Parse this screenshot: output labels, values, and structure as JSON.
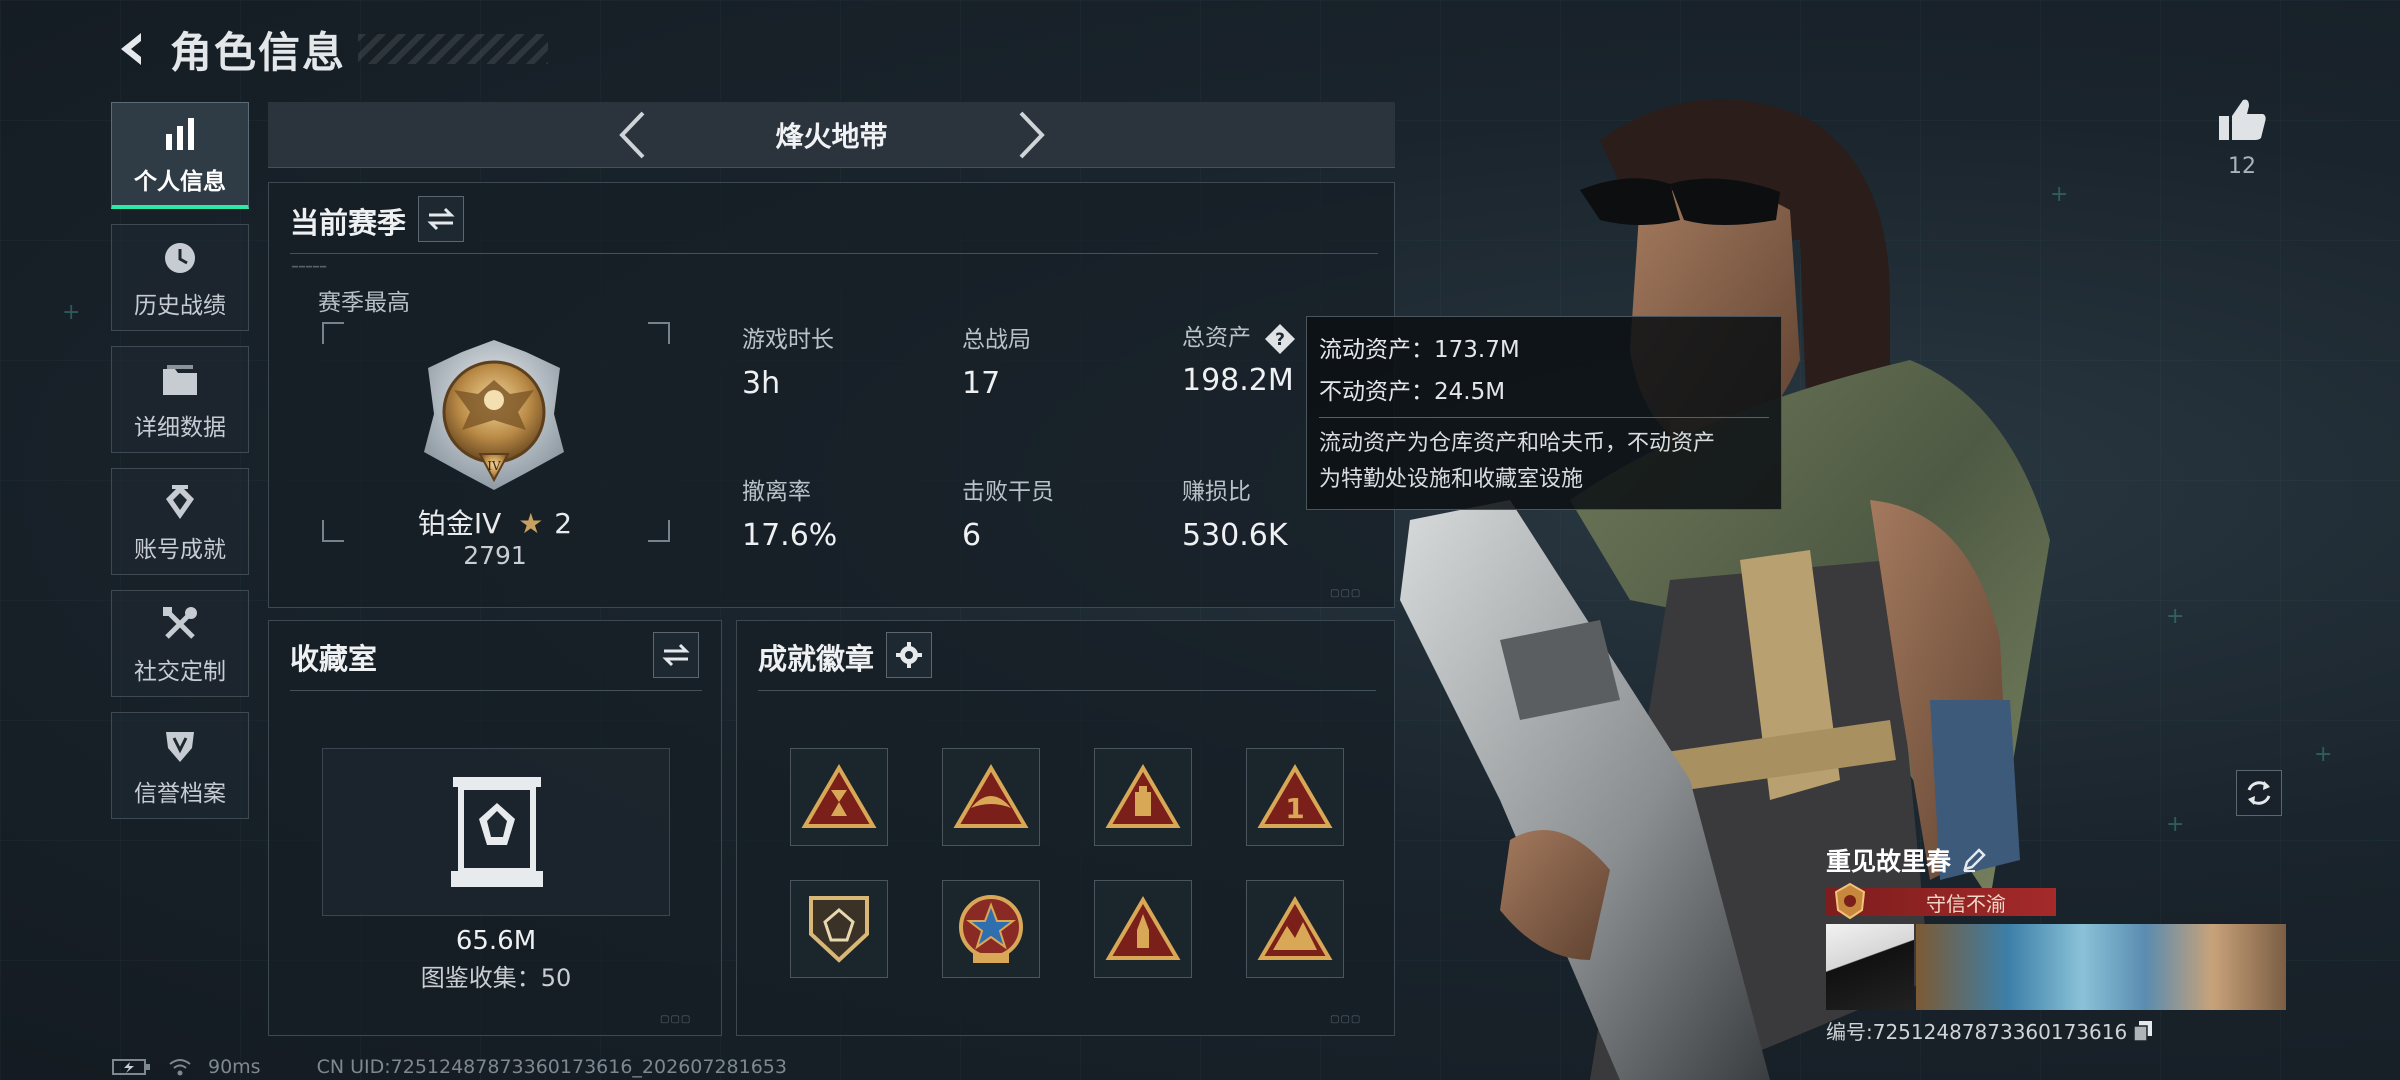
{
  "header": {
    "title": "角色信息"
  },
  "sidebar": {
    "items": [
      {
        "label": "个人信息",
        "icon": "bar-chart-icon",
        "active": true
      },
      {
        "label": "历史战绩",
        "icon": "history-icon",
        "active": false
      },
      {
        "label": "详细数据",
        "icon": "folder-icon",
        "active": false
      },
      {
        "label": "账号成就",
        "icon": "achievement-icon",
        "active": false
      },
      {
        "label": "社交定制",
        "icon": "tools-icon",
        "active": false
      },
      {
        "label": "信誉档案",
        "icon": "shield-icon",
        "active": false
      }
    ]
  },
  "mode": {
    "name": "烽火地带"
  },
  "season": {
    "title": "当前赛季",
    "best_label": "赛季最高",
    "rank_name": "铂金IV",
    "rank_stars": "2",
    "rank_score": "2791",
    "stats": {
      "play_time": {
        "label": "游戏时长",
        "value": "3h"
      },
      "total_matches": {
        "label": "总战局",
        "value": "17"
      },
      "total_assets": {
        "label": "总资产",
        "value": "198.2M"
      },
      "extract_rate": {
        "label": "撤离率",
        "value": "17.6%"
      },
      "kills": {
        "label": "击败干员",
        "value": "6"
      },
      "profit_ratio": {
        "label": "赚损比",
        "value": "530.6K"
      }
    }
  },
  "tooltip": {
    "liquid": "流动资产：173.7M",
    "fixed": "不动资产：24.5M",
    "desc_line1": "流动资产为仓库资产和哈夫币，不动资产",
    "desc_line2": "为特勤处设施和收藏室设施"
  },
  "collection": {
    "title": "收藏室",
    "value": "65.6M",
    "count": "图鉴收集：50"
  },
  "badges": {
    "title": "成就徽章"
  },
  "player": {
    "likes": "12",
    "name": "重见故里春",
    "honor": "守信不渝",
    "id": "编号:72512487873360173616"
  },
  "status": {
    "ping": "90ms",
    "uid": "CN UID:72512487873360173616_202607281653"
  },
  "colors": {
    "accent": "#2ee8a8",
    "honor_red": "#a52a2a",
    "gold": "#c8a060"
  }
}
